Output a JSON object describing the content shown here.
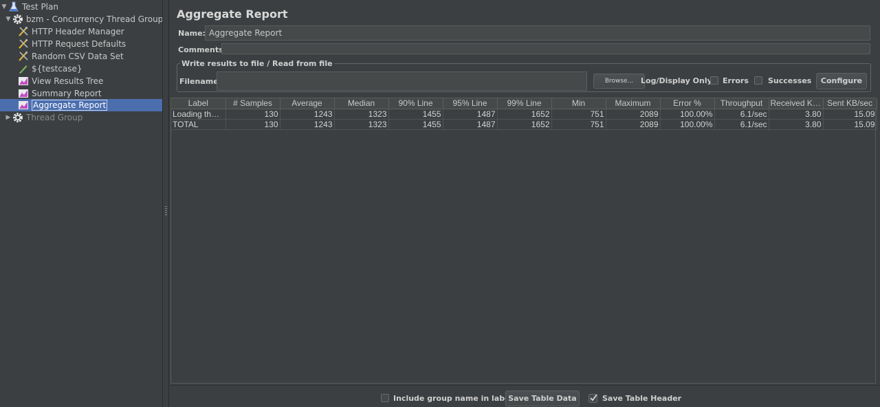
{
  "tree": {
    "items": [
      {
        "label": "Test Plan",
        "icon": "flask-icon"
      },
      {
        "label": "bzm - Concurrency Thread Group",
        "icon": "gear-icon"
      },
      {
        "label": "HTTP Header Manager",
        "icon": "wrench-icon"
      },
      {
        "label": "HTTP Request Defaults",
        "icon": "wrench-icon"
      },
      {
        "label": "Random CSV Data Set",
        "icon": "wrench-icon"
      },
      {
        "label": "${testcase}",
        "icon": "pencil-icon"
      },
      {
        "label": "View Results Tree",
        "icon": "graph-icon"
      },
      {
        "label": "Summary Report",
        "icon": "graph-icon"
      },
      {
        "label": "Aggregate Report",
        "icon": "graph-icon"
      },
      {
        "label": "Thread Group",
        "icon": "gear-icon"
      }
    ]
  },
  "main": {
    "title": "Aggregate Report",
    "name_label": "Name:",
    "name_value": "Aggregate Report",
    "comments_label": "Comments:",
    "comments_value": "",
    "file_group_legend": "Write results to file / Read from file",
    "filename_label": "Filename",
    "filename_value": "",
    "browse_button": "Browse...",
    "log_display_label": "Log/Display Only:",
    "errors_label": "Errors",
    "successes_label": "Successes",
    "configure_button": "Configure"
  },
  "table": {
    "columns": [
      "Label",
      "# Samples",
      "Average",
      "Median",
      "90% Line",
      "95% Line",
      "99% Line",
      "Min",
      "Maximum",
      "Error %",
      "Throughput",
      "Received KB/...",
      "Sent KB/sec"
    ],
    "rows": [
      [
        "Loading the ...",
        "130",
        "1243",
        "1323",
        "1455",
        "1487",
        "1652",
        "751",
        "2089",
        "100.00%",
        "6.1/sec",
        "3.80",
        "15.09"
      ],
      [
        "TOTAL",
        "130",
        "1243",
        "1323",
        "1455",
        "1487",
        "1652",
        "751",
        "2089",
        "100.00%",
        "6.1/sec",
        "3.80",
        "15.09"
      ]
    ]
  },
  "bottom": {
    "include_group_label": "Include group name in label?",
    "include_group_checked": false,
    "save_table_data_button": "Save Table Data",
    "save_table_header_label": "Save Table Header",
    "save_table_header_checked": true
  },
  "colors": {
    "selection": "#4b6eaf",
    "background": "#3c3f41"
  }
}
